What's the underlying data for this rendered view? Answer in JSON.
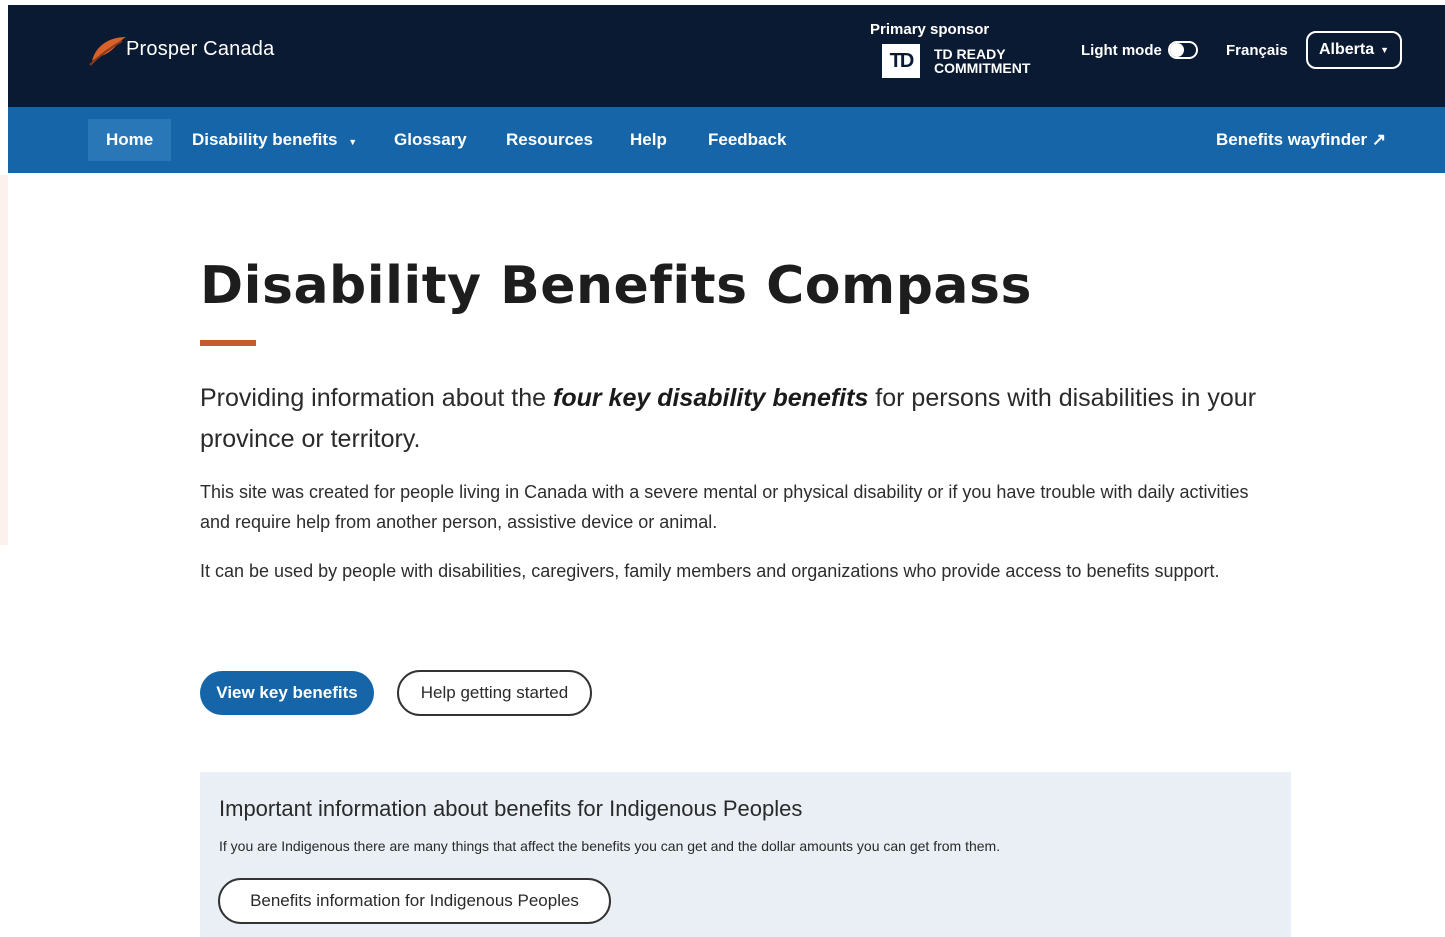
{
  "header": {
    "logo_text": "Prosper Canada",
    "sponsor_label": "Primary sponsor",
    "sponsor_logo": "TD",
    "sponsor_line1": "TD READY",
    "sponsor_line2": "COMMITMENT",
    "light_mode_label": "Light mode",
    "language_link": "Français",
    "province_selected": "Alberta"
  },
  "nav": {
    "items": [
      {
        "label": "Home",
        "active": true
      },
      {
        "label": "Disability benefits",
        "has_dropdown": true
      },
      {
        "label": "Glossary"
      },
      {
        "label": "Resources"
      },
      {
        "label": "Help"
      },
      {
        "label": "Feedback"
      }
    ],
    "wayfinder_label": "Benefits wayfinder"
  },
  "main": {
    "title": "Disability Benefits Compass",
    "lead_before": "Providing information about the ",
    "lead_emphasis": "four key disability benefits",
    "lead_after": " for persons with disabilities in your province or territory.",
    "paragraph1": "This site was created for people living in Canada with a severe mental or physical disability or if you have trouble with daily activities and require help from another person, assistive device or animal.",
    "paragraph2": "It can be used by people with disabilities, caregivers, family members and organizations who provide access to benefits support.",
    "primary_button": "View key benefits",
    "secondary_button": "Help getting started"
  },
  "info_box": {
    "title": "Important information about benefits for Indigenous Peoples",
    "text": "If you are Indigenous there are many things that affect the benefits you can get and the dollar amounts you can get from them.",
    "button": "Benefits information for Indigenous Peoples"
  },
  "colors": {
    "header_bg": "#0b1a33",
    "nav_bg": "#1565a8",
    "accent": "#c65a2c",
    "info_bg": "#e9eff5"
  }
}
